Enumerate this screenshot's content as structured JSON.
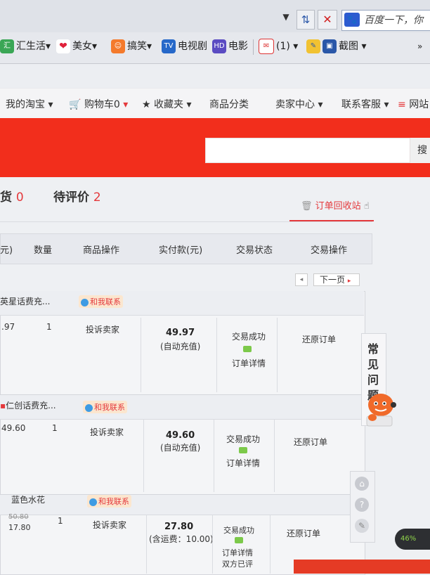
{
  "browser": {
    "search_text": "百度一下，你",
    "refresh_icon": "refresh-icon",
    "stop_icon": "close-icon"
  },
  "favorites": [
    {
      "label": "汇生活",
      "icon": "huishenghuo-icon",
      "dropdown": true
    },
    {
      "label": "美女",
      "icon": "lips-icon",
      "dropdown": true
    },
    {
      "label": "搞笑",
      "icon": "smile-face-icon",
      "dropdown": true
    },
    {
      "label": "电视剧",
      "icon": "tv-icon",
      "badge": "TV",
      "dropdown": false
    },
    {
      "label": "电影",
      "icon": "hd-icon",
      "badge": "HD",
      "dropdown": false
    },
    {
      "label": "(1)",
      "icon": "mail-icon",
      "dropdown": true
    },
    {
      "label": "截图",
      "icon": "screenshot-icon",
      "dropdown": true
    }
  ],
  "nav": {
    "my_taobao": "我的淘宝",
    "cart": "购物车0",
    "favorites": "收藏夹",
    "categories": "商品分类",
    "seller_center": "卖家中心",
    "support": "联系客服",
    "site_nav": "网站"
  },
  "search_button": "搜",
  "tabs": {
    "pending_receive": {
      "label": "货",
      "count": "0"
    },
    "pending_review": {
      "label": "待评价",
      "count": "2"
    },
    "recycle_bin": "订单回收站"
  },
  "table_headers": [
    "元)",
    "数量",
    "商品操作",
    "实付款(元)",
    "交易状态",
    "交易操作"
  ],
  "pager": {
    "prev": "◂",
    "next": "下一页"
  },
  "orders": [
    {
      "title": "英星话费充...",
      "contact": "和我联系",
      "price": ".97",
      "qty": "1",
      "op": "投诉卖家",
      "amount": "49.97",
      "amount_note": "(自动充值)",
      "status": "交易成功",
      "detail": "订单详情",
      "extra": "",
      "action": "还原订单",
      "old_price": ""
    },
    {
      "title": "仁创话费充...",
      "contact": "和我联系",
      "price": "49.60",
      "qty": "1",
      "op": "投诉卖家",
      "amount": "49.60",
      "amount_note": "(自动充值)",
      "status": "交易成功",
      "detail": "订单详情",
      "extra": "",
      "action": "还原订单",
      "old_price": ""
    },
    {
      "title": "蓝色水花",
      "contact": "和我联系",
      "price": "17.80",
      "qty": "1",
      "op": "投诉卖家",
      "amount": "27.80",
      "amount_note": "(含运费：10.00)",
      "status": "交易成功",
      "detail": "订单详情",
      "extra": "双方已评",
      "action": "还原订单",
      "old_price": "50.80"
    }
  ],
  "faq": [
    "常",
    "见",
    "问",
    "题"
  ],
  "badge_text": "46%",
  "colors": {
    "accent": "#f22e1c",
    "link_red": "#e4393c"
  }
}
